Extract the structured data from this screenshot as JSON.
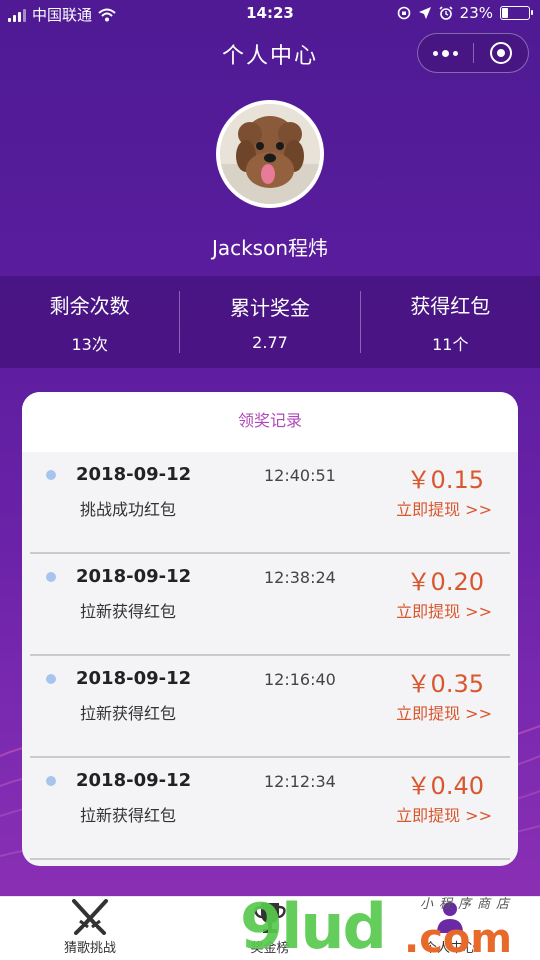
{
  "status_bar": {
    "carrier": "中国联通",
    "time": "14:23",
    "battery": "23%",
    "battery_level": 0.23
  },
  "nav": {
    "title": "个人中心",
    "more_icon": "more-dots-icon",
    "close_icon": "target-circle-icon"
  },
  "profile": {
    "username": "Jackson程炜",
    "avatar_icon": "dog-avatar"
  },
  "stats": [
    {
      "label": "剩余次数",
      "value": "13次"
    },
    {
      "label": "累计奖金",
      "value": "2.77"
    },
    {
      "label": "获得红包",
      "value": "11个"
    }
  ],
  "records": {
    "title": "领奖记录",
    "items": [
      {
        "date": "2018-09-12",
        "time": "12:40:51",
        "desc": "挑战成功红包",
        "amount": "￥0.15",
        "action": "立即提现 >>"
      },
      {
        "date": "2018-09-12",
        "time": "12:38:24",
        "desc": "拉新获得红包",
        "amount": "￥0.20",
        "action": "立即提现 >>"
      },
      {
        "date": "2018-09-12",
        "time": "12:16:40",
        "desc": "拉新获得红包",
        "amount": "￥0.35",
        "action": "立即提现 >>"
      },
      {
        "date": "2018-09-12",
        "time": "12:12:34",
        "desc": "拉新获得红包",
        "amount": "￥0.40",
        "action": "立即提现 >>"
      }
    ]
  },
  "tabbar": {
    "tabs": [
      {
        "label": "猜歌挑战",
        "icon": "crossed-swords-icon"
      },
      {
        "label": "奖金榜",
        "icon": "trophy-icon"
      },
      {
        "label": "个人中心",
        "icon": "person-icon"
      }
    ]
  },
  "watermark": {
    "main": "9lud",
    "suffix": ".com",
    "small": "小程序商店"
  },
  "colors": {
    "accent_purple": "#5a1d9e",
    "amount_red": "#d8572e",
    "card_title": "#b04ab8",
    "dot_blue": "#a7c4ef"
  }
}
